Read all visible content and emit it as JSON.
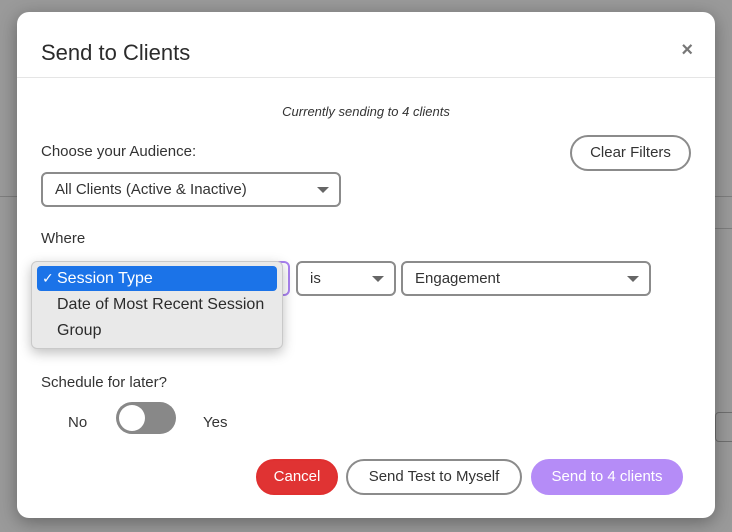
{
  "modal": {
    "title": "Send to Clients",
    "close_label": "×",
    "sending_note": "Currently sending to 4 clients"
  },
  "audience": {
    "label": "Choose your Audience:",
    "selected": "All Clients (Active & Inactive)",
    "clear_filters_label": "Clear Filters"
  },
  "filter": {
    "where_label": "Where",
    "operator": "is",
    "value": "Engagement",
    "field_options": [
      {
        "label": "Session Type",
        "selected": true
      },
      {
        "label": "Date of Most Recent Session",
        "selected": false
      },
      {
        "label": "Group",
        "selected": false
      }
    ],
    "check_mark": "✓"
  },
  "schedule": {
    "label": "Schedule for later?",
    "no_label": "No",
    "yes_label": "Yes",
    "enabled": false
  },
  "actions": {
    "cancel_label": "Cancel",
    "send_test_label": "Send Test to Myself",
    "send_label": "Send to 4 clients"
  },
  "colors": {
    "cancel": "#e03333",
    "send": "#b58cf7",
    "selected_option": "#1b73e8"
  }
}
